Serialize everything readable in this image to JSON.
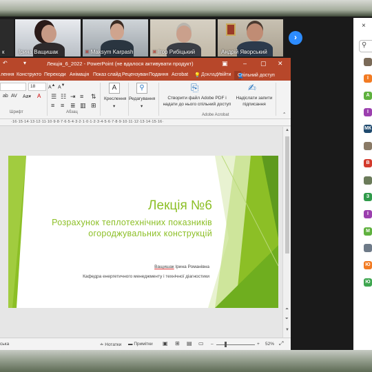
{
  "meeting": {
    "participants_video": [
      {
        "name": "к"
      },
      {
        "name": "Ірина Ващишак"
      },
      {
        "name": "Maksym Karpash"
      },
      {
        "name": "Ігор Рибіцький"
      },
      {
        "name": "Андрій Яворський"
      }
    ],
    "next_arrow": "›"
  },
  "participants_panel": {
    "close": "×",
    "search_icon": "search-icon",
    "avatars": [
      {
        "letter": "",
        "color": "#7a6a58"
      },
      {
        "letter": "І",
        "color": "#f27b23"
      },
      {
        "letter": "А",
        "color": "#5fb13e"
      },
      {
        "letter": "І",
        "color": "#9b3fae"
      },
      {
        "letter": "МК",
        "color": "#1f4a6e"
      },
      {
        "letter": "",
        "color": "#8a7a66"
      },
      {
        "letter": "В",
        "color": "#d33a2c"
      },
      {
        "letter": "",
        "color": "#6b7b5a"
      },
      {
        "letter": "З",
        "color": "#2f9a4a"
      },
      {
        "letter": "І",
        "color": "#9b3fae"
      },
      {
        "letter": "М",
        "color": "#5fb13e"
      },
      {
        "letter": "",
        "color": "#6e7a88"
      },
      {
        "letter": "Ю",
        "color": "#f27b23"
      },
      {
        "letter": "Ю",
        "color": "#3ea64f"
      }
    ]
  },
  "ppt": {
    "title": "Лекція_6_2022 - PowerPoint (не вдалося активувати продукт)",
    "tabs": [
      "лення",
      "Конструкто",
      "Переходи",
      "Анімація",
      "Показ слайд",
      "Рецензуван",
      "Подання",
      "Acrobat",
      "Доклад",
      "Увійти"
    ],
    "share_label": "Спільний доступ",
    "ribbon": {
      "font_group": "Шрифт",
      "paragraph_group": "Абзац",
      "font_size": "18",
      "draw_label": "Креслення",
      "edit_label": "Редагування",
      "create_pdf": "Створити файл Adobe PDF і надати до нього спільний доступ",
      "send_sign": "Надіслати запити підписання",
      "acrobat_group": "Adobe Acrobat"
    },
    "ruler_text": "·16·15·14·13·12·11·10·9·8·7·6·5·4·3·2·1·0·1·2·3·4·5·6·7·8·9·10·11·12·13·14·15·16·",
    "slide": {
      "title": "Лекція №6",
      "subtitle": "Розрахунок теплотехнічних показників огороджувальних конструкцій",
      "author_surname": "Ващишак",
      "author_rest": " Ірина Романівна",
      "department": "Кафедра енергетичного менеджменту і технічної діагностики"
    },
    "status": {
      "left": "ська",
      "notes": "Нотатки",
      "comments": "Примітки",
      "zoom": "52%"
    }
  },
  "colors": {
    "ppt_accent": "#b7472a",
    "slide_green": "#8cbf26",
    "zoom_blue": "#2d8cff"
  }
}
